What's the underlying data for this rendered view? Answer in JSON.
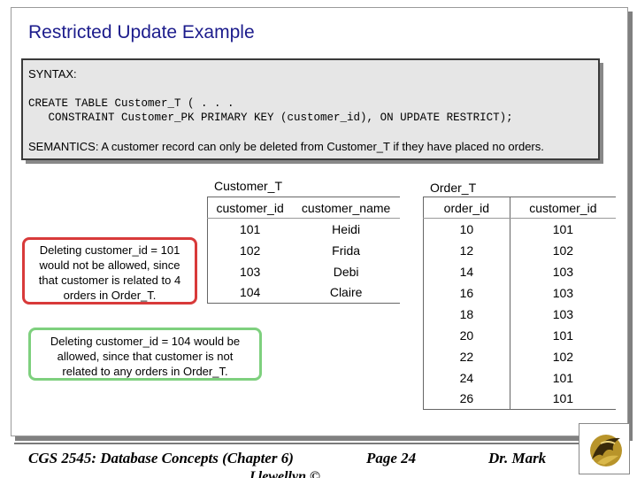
{
  "slide": {
    "title": "Restricted Update Example",
    "syntax_label": "SYNTAX:",
    "code_line1": "CREATE TABLE Customer_T ( . . .",
    "code_line2": "   CONSTRAINT Customer_PK PRIMARY KEY (customer_id), ON UPDATE RESTRICT);",
    "semantics": "SEMANTICS:  A customer record can only be deleted from Customer_T if they have placed no orders."
  },
  "customer_table": {
    "title": "Customer_T",
    "headers": [
      "customer_id",
      "customer_name"
    ],
    "rows": [
      [
        "101",
        "Heidi"
      ],
      [
        "102",
        "Frida"
      ],
      [
        "103",
        "Debi"
      ],
      [
        "104",
        "Claire"
      ]
    ]
  },
  "order_table": {
    "title": "Order_T",
    "headers": [
      "order_id",
      "customer_id"
    ],
    "rows": [
      [
        "10",
        "101"
      ],
      [
        "12",
        "102"
      ],
      [
        "14",
        "103"
      ],
      [
        "16",
        "103"
      ],
      [
        "18",
        "103"
      ],
      [
        "20",
        "101"
      ],
      [
        "22",
        "102"
      ],
      [
        "24",
        "101"
      ],
      [
        "26",
        "101"
      ]
    ]
  },
  "notes": {
    "red": [
      "Deleting customer_id = 101",
      "would not be allowed, since",
      "that customer is related to 4",
      "orders in Order_T."
    ],
    "green": [
      "Deleting customer_id = 104 would be",
      "allowed, since that customer is not",
      "related to any orders in Order_T."
    ]
  },
  "footer": {
    "course": "CGS 2545: Database Concepts  (Chapter 6)",
    "page": "Page 24",
    "author": "Dr. Mark",
    "author2": "Llewellyn ©"
  }
}
